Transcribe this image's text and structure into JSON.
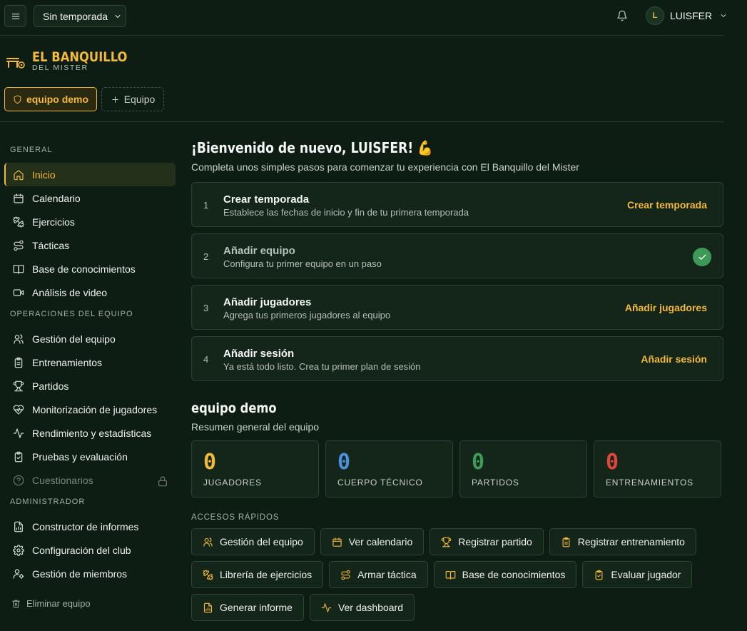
{
  "topbar": {
    "season": "Sin temporada",
    "user": {
      "initial": "L",
      "name": "LUISFER"
    }
  },
  "brand": {
    "title": "EL BANQUILLO",
    "subtitle": "DEL MISTER"
  },
  "teams": {
    "active": "equipo demo",
    "add_label": "Equipo"
  },
  "sidebar": {
    "sections": [
      {
        "title": "GENERAL",
        "items": [
          {
            "label": "Inicio",
            "icon": "home-icon",
            "active": true
          },
          {
            "label": "Calendario",
            "icon": "calendar-icon"
          },
          {
            "label": "Ejercicios",
            "icon": "dumbbell-icon"
          },
          {
            "label": "Tácticas",
            "icon": "route-icon"
          },
          {
            "label": "Base de conocimientos",
            "icon": "book-icon"
          },
          {
            "label": "Análisis de video",
            "icon": "video-icon"
          }
        ]
      },
      {
        "title": "OPERACIONES DEL EQUIPO",
        "items": [
          {
            "label": "Gestión del equipo",
            "icon": "users-icon"
          },
          {
            "label": "Entrenamientos",
            "icon": "clipboard-icon"
          },
          {
            "label": "Partidos",
            "icon": "trophy-icon"
          },
          {
            "label": "Monitorización de jugadores",
            "icon": "heart-pulse-icon"
          },
          {
            "label": "Rendimiento y estadísticas",
            "icon": "activity-icon"
          },
          {
            "label": "Pruebas y evaluación",
            "icon": "clipboard-check-icon"
          },
          {
            "label": "Cuestionarios",
            "icon": "help-circle-icon",
            "locked": true
          }
        ]
      },
      {
        "title": "ADMINISTRADOR",
        "items": [
          {
            "label": "Constructor de informes",
            "icon": "file-chart-icon"
          },
          {
            "label": "Configuración del club",
            "icon": "settings-icon"
          },
          {
            "label": "Gestión de miembros",
            "icon": "user-cog-icon"
          }
        ]
      }
    ],
    "delete_team": "Eliminar equipo"
  },
  "welcome": {
    "title": "¡Bienvenido de nuevo, LUISFER! 💪",
    "subtitle": "Completa unos simples pasos para comenzar tu experiencia con El Banquillo del Mister"
  },
  "steps": [
    {
      "num": "1",
      "title": "Crear temporada",
      "desc": "Establece las fechas de inicio y fin de tu primera temporada",
      "action": "Crear temporada",
      "done": false
    },
    {
      "num": "2",
      "title": "Añadir equipo",
      "desc": "Configura tu primer equipo en un paso",
      "action": "",
      "done": true
    },
    {
      "num": "3",
      "title": "Añadir jugadores",
      "desc": "Agrega tus primeros jugadores al equipo",
      "action": "Añadir jugadores",
      "done": false
    },
    {
      "num": "4",
      "title": "Añadir sesión",
      "desc": "Ya está todo listo. Crea tu primer plan de sesión",
      "action": "Añadir sesión",
      "done": false
    }
  ],
  "team_summary": {
    "title": "equipo demo",
    "subtitle": "Resumen general del equipo",
    "stats": [
      {
        "value": "0",
        "label": "JUGADORES",
        "color": "#f3b93a"
      },
      {
        "value": "0",
        "label": "CUERPO TÉCNICO",
        "color": "#4a8fe0"
      },
      {
        "value": "0",
        "label": "PARTIDOS",
        "color": "#3c9a58"
      },
      {
        "value": "0",
        "label": "ENTRENAMIENTOS",
        "color": "#e0463a"
      }
    ]
  },
  "quick_access": {
    "title": "ACCESOS RÁPIDOS",
    "items": [
      {
        "label": "Gestión del equipo",
        "icon": "users-icon"
      },
      {
        "label": "Ver calendario",
        "icon": "calendar-icon"
      },
      {
        "label": "Registrar partido",
        "icon": "trophy-icon"
      },
      {
        "label": "Registrar entrenamiento",
        "icon": "clipboard-icon"
      },
      {
        "label": "Librería de ejercicios",
        "icon": "dumbbell-icon"
      },
      {
        "label": "Armar táctica",
        "icon": "route-icon"
      },
      {
        "label": "Base de conocimientos",
        "icon": "book-icon"
      },
      {
        "label": "Evaluar jugador",
        "icon": "clipboard-check-icon"
      },
      {
        "label": "Generar informe",
        "icon": "file-chart-icon"
      },
      {
        "label": "Ver dashboard",
        "icon": "activity-icon"
      }
    ]
  },
  "colors": {
    "accent": "#f3b93a",
    "background": "#0e1d13",
    "card": "#142519",
    "success": "#3c9a58"
  }
}
